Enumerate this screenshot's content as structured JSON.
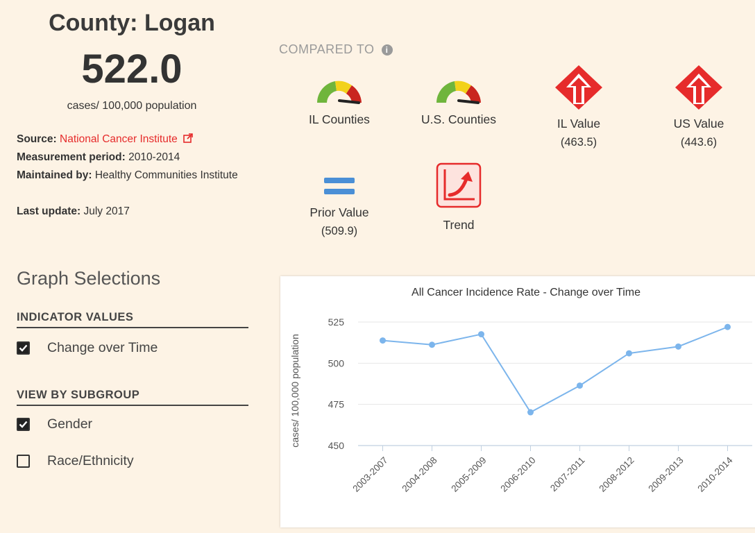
{
  "header": {
    "county_title": "County: Logan",
    "value": "522.0",
    "unit": "cases/ 100,000 population"
  },
  "meta": {
    "source_label": "Source:",
    "source_value": "National Cancer Institute",
    "period_label": "Measurement period:",
    "period_value": "2010-2014",
    "maintained_label": "Maintained by:",
    "maintained_value": "Healthy Communities Institute",
    "update_label": "Last update:",
    "update_value": "July 2017"
  },
  "compared": {
    "heading": "COMPARED TO",
    "info_icon": "info-icon",
    "il_counties": "IL Counties",
    "us_counties": "U.S. Counties",
    "il_value_label": "IL Value",
    "il_value": "(463.5)",
    "us_value_label": "US Value",
    "us_value": "(443.6)",
    "prior_label": "Prior Value",
    "prior_value": "(509.9)",
    "trend_label": "Trend"
  },
  "colors": {
    "background": "#fdf3e5",
    "link": "#e62b2b",
    "alert_red": "#e62b2b",
    "equal_blue": "#4a8fd6",
    "gauge_green": "#6fb53c",
    "gauge_yellow": "#f2d21b",
    "gauge_red": "#c9251f",
    "series": "#7cb5ec"
  },
  "graph_selections": {
    "heading": "Graph Selections",
    "indicator_heading": "INDICATOR VALUES",
    "change_over_time": "Change over Time",
    "change_over_time_checked": true,
    "subgroup_heading": "VIEW BY SUBGROUP",
    "gender": "Gender",
    "gender_checked": true,
    "race": "Race/Ethnicity",
    "race_checked": false
  },
  "chart_data": {
    "type": "line",
    "title": "All Cancer Incidence Rate - Change over Time",
    "xlabel": "",
    "ylabel": "cases/ 100,000 population",
    "categories": [
      "2003-2007",
      "2004-2008",
      "2005-2009",
      "2006-2010",
      "2007-2011",
      "2008-2012",
      "2009-2013",
      "2010-2014"
    ],
    "series": [
      {
        "values": [
          513.8,
          511.2,
          517.6,
          470.2,
          486.4,
          506.0,
          510.1,
          522.0
        ]
      }
    ],
    "ylim": [
      450,
      525
    ],
    "yticks": [
      450,
      475,
      500,
      525
    ],
    "grid": true,
    "legend": "none"
  }
}
